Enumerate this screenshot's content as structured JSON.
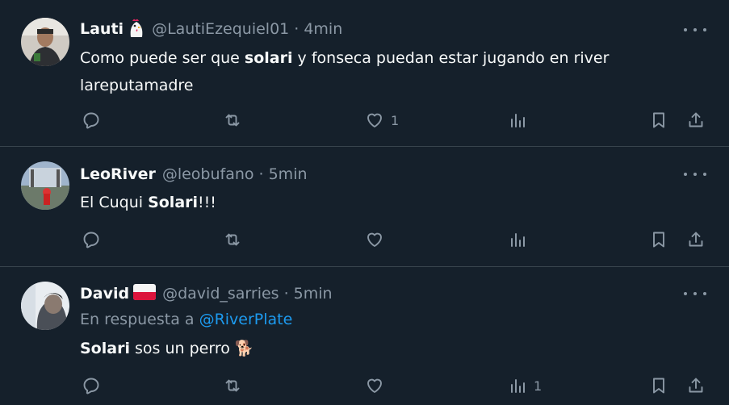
{
  "tweets": [
    {
      "name": "Lauti",
      "name_emoji": "🐔",
      "handle": "@LautiEzequiel01",
      "separator": "·",
      "time": "4min",
      "text_parts": [
        "Como puede ser que ",
        "solari",
        " y fonseca puedan estar jugando en river",
        "lareputamadre"
      ],
      "likes": "1",
      "views": ""
    },
    {
      "name": "LeoRiver",
      "handle": "@leobufano",
      "separator": "·",
      "time": "5min",
      "text_parts": [
        "El Cuqui ",
        "Solari",
        "!!!"
      ],
      "likes": "",
      "views": ""
    },
    {
      "name": "David",
      "name_emoji": "flag-poland",
      "handle": "@david_sarries",
      "separator": "·",
      "time": "5min",
      "reply_prefix": "En respuesta a ",
      "reply_to": "@RiverPlate",
      "text_parts": [
        "Solari",
        " sos un perro ",
        "🐕"
      ],
      "likes": "",
      "views": "1"
    }
  ],
  "colors": {
    "background": "#15202b",
    "separator": "#38444d",
    "secondary_text": "#8b98a5",
    "link": "#1d9bf0"
  }
}
